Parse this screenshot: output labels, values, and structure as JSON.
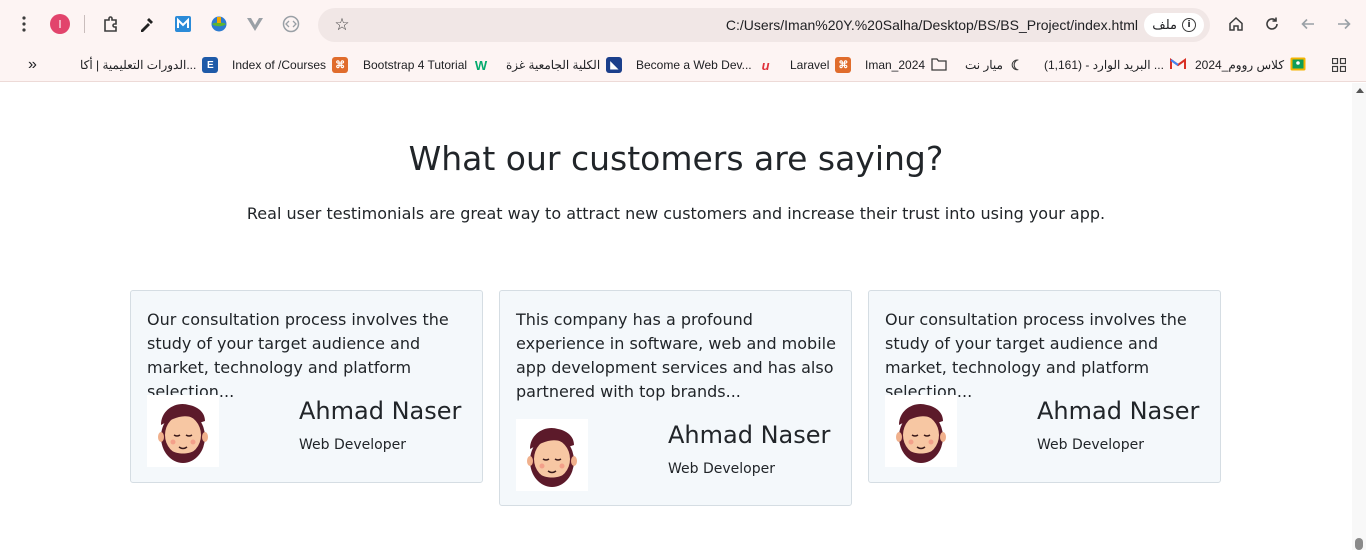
{
  "browser": {
    "url": "C:/Users/Iman%20Y.%20Salha/Desktop/BS/BS_Project/index.html",
    "site_chip_label": "ملف",
    "profile_initial": "I"
  },
  "bookmarks": [
    {
      "label": "الدورات التعليمية | أكا...",
      "icon": "E",
      "color": "#1e5aa8"
    },
    {
      "label": "Index of /Courses",
      "icon": "⌘",
      "color": "#e06c2c"
    },
    {
      "label": "Bootstrap 4 Tutorial",
      "icon": "W",
      "color": "#04aa6d"
    },
    {
      "label": "الكلية الجامعية غزة",
      "icon": "◣",
      "color": "#1b3f8b"
    },
    {
      "label": "Become a Web Dev...",
      "icon": "u",
      "color": "#e0323c"
    },
    {
      "label": "Laravel",
      "icon": "⌘",
      "color": "#e06c2c"
    },
    {
      "label": "Iman_2024",
      "icon": "folder",
      "color": "#3c3c3c"
    },
    {
      "label": "ميار نت",
      "icon": "☾",
      "color": "#3c3c3c"
    },
    {
      "label": "البريد الوارد - (1,161) ...",
      "icon": "M",
      "color": "#d93025"
    },
    {
      "label": "كلاس رووم_2024",
      "icon": "■",
      "color": "#f4b400"
    }
  ],
  "section": {
    "title": "What our customers are saying?",
    "lead": "Real user testimonials are great way to attract new customers and increase their trust into using your app."
  },
  "testimonials": [
    {
      "quote": "Our consultation process involves the study of your target audience and market, technology and platform selection...",
      "name": "Ahmad Naser",
      "role": "Web Developer"
    },
    {
      "quote": "This company has a profound experience in software, web and mobile app development services and has also partnered with top brands...",
      "name": "Ahmad Naser",
      "role": "Web Developer"
    },
    {
      "quote": "Our consultation process involves the study of your target audience and market, technology and platform selection...",
      "name": "Ahmad Naser",
      "role": "Web Developer"
    }
  ]
}
